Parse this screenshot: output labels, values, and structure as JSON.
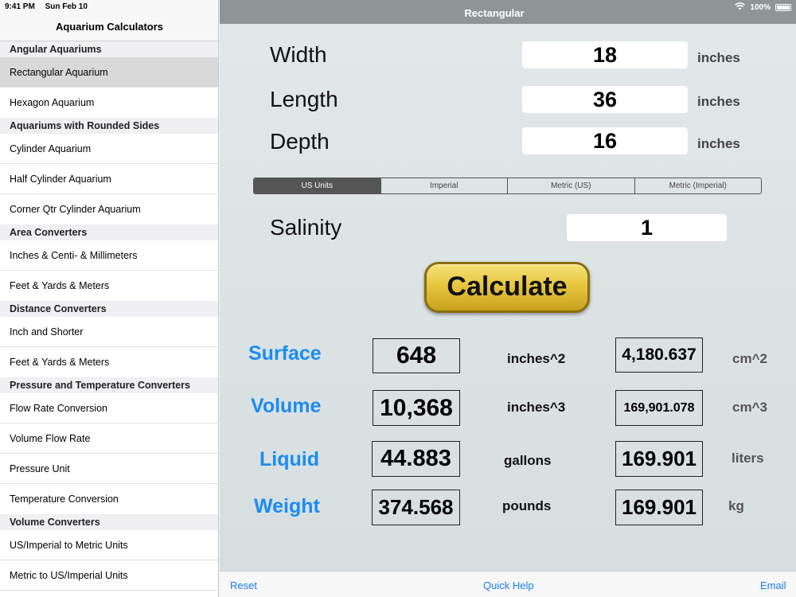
{
  "status": {
    "time": "9:41 PM",
    "date": "Sun Feb 10",
    "battery": "100%"
  },
  "sidebar": {
    "title": "Aquarium Calculators",
    "groups": [
      {
        "header": "Angular Aquariums",
        "items": [
          "Rectangular Aquarium",
          "Hexagon Aquarium"
        ]
      },
      {
        "header": "Aquariums with Rounded Sides",
        "items": [
          "Cylinder Aquarium",
          "Half Cylinder Aquarium",
          "Corner Qtr Cylinder Aquarium"
        ]
      },
      {
        "header": "Area Converters",
        "items": [
          "Inches & Centi- & Millimeters",
          "Feet & Yards & Meters"
        ]
      },
      {
        "header": "Distance Converters",
        "items": [
          "Inch and Shorter",
          "Feet & Yards & Meters"
        ]
      },
      {
        "header": "Pressure and Temperature Converters",
        "items": [
          "Flow Rate Conversion",
          "Volume Flow Rate",
          "Pressure Unit",
          "Temperature Conversion"
        ]
      },
      {
        "header": "Volume Converters",
        "items": [
          "US/Imperial to Metric Units",
          "Metric to US/Imperial Units"
        ]
      }
    ]
  },
  "main": {
    "title": "Rectangular",
    "dimensions": [
      {
        "label": "Width",
        "value": "18",
        "unit": "inches"
      },
      {
        "label": "Length",
        "value": "36",
        "unit": "inches"
      },
      {
        "label": "Depth",
        "value": "16",
        "unit": "inches"
      }
    ],
    "unit_tabs": [
      "US Units",
      "Imperial",
      "Metric (US)",
      "Metric (Imperial)"
    ],
    "selected_unit_tab": "US Units",
    "salinity": {
      "label": "Salinity",
      "value": "1"
    },
    "calculate_label": "Calculate",
    "results": [
      {
        "label": "Surface",
        "us_value": "648",
        "us_unit": "inches^2",
        "metric_value": "4,180.637",
        "metric_unit": "cm^2"
      },
      {
        "label": "Volume",
        "us_value": "10,368",
        "us_unit": "inches^3",
        "metric_value": "169,901.078",
        "metric_unit": "cm^3"
      },
      {
        "label": "Liquid",
        "us_value": "44.883",
        "us_unit": "gallons",
        "metric_value": "169.901",
        "metric_unit": "liters"
      },
      {
        "label": "Weight",
        "us_value": "374.568",
        "us_unit": "pounds",
        "metric_value": "169.901",
        "metric_unit": "kg"
      }
    ]
  },
  "bottombar": {
    "reset": "Reset",
    "help": "Quick Help",
    "email": "Email"
  },
  "colors": {
    "accent": "#1a8cf0",
    "link": "#1a7cf0",
    "button_gold": "#e7c640"
  }
}
